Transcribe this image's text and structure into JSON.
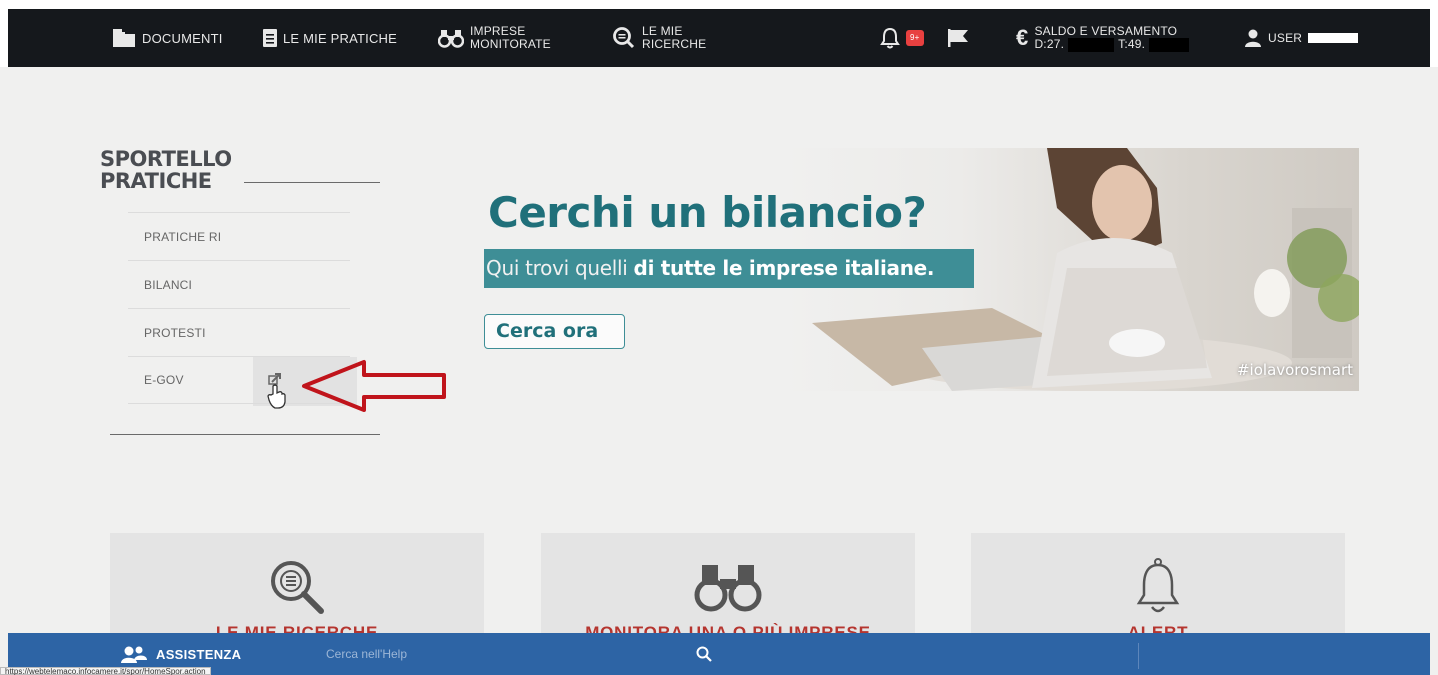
{
  "nav": {
    "documenti": "DOCUMENTI",
    "pratiche": "LE MIE PRATICHE",
    "imprese_1": "IMPRESE",
    "imprese_2": "MONITORATE",
    "ricerche_1": "LE MIE",
    "ricerche_2": "RICERCHE",
    "badge": "9+",
    "saldo": "SALDO E VERSAMENTO",
    "saldo_d": "D:27.",
    "saldo_t": "T:49.",
    "user": "USER"
  },
  "sidebar": {
    "title_1": "SPORTELLO",
    "title_2": "PRATICHE",
    "items": [
      "PRATICHE RI",
      "BILANCI",
      "PROTESTI",
      "E-GOV"
    ]
  },
  "banner": {
    "title": "Cerchi un bilancio?",
    "subtitle_plain": "Qui trovi quelli ",
    "subtitle_bold": "di tutte le imprese italiane.",
    "button": "Cerca ora",
    "hashtag": "#iolavorosmart"
  },
  "cards": [
    "LE MIE RICERCHE",
    "MONITORA UNA O PIÙ IMPRESE",
    "ALERT"
  ],
  "bottom": {
    "assist": "ASSISTENZA",
    "help_placeholder": "Cerca nell'Help"
  },
  "status_url": "https://webtelemaco.infocamere.it/spor/HomeSpor.action",
  "colors": {
    "nav_bg": "#15181c",
    "accent_teal": "#3e8e96",
    "bottom_blue": "#2d64a5",
    "arrow_red": "#c0141b"
  }
}
